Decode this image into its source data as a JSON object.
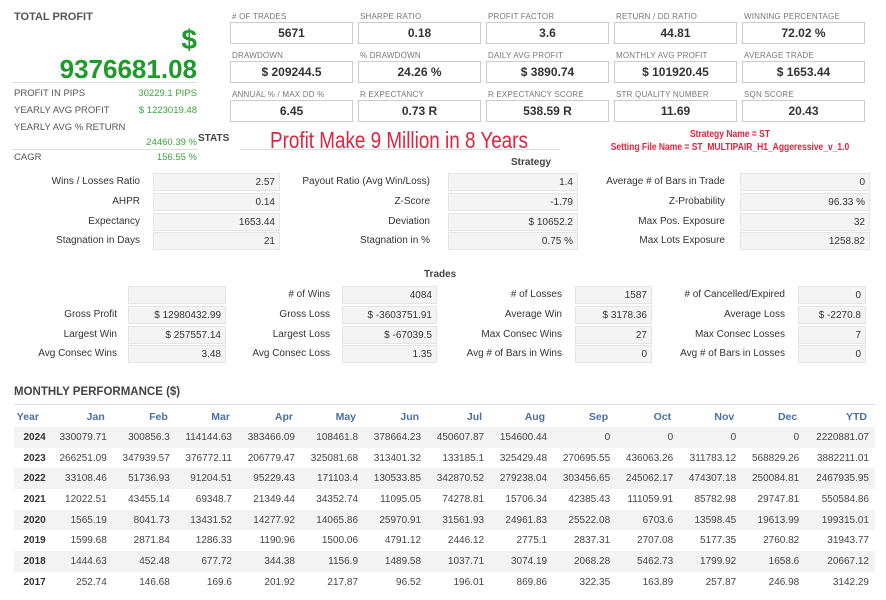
{
  "summary": {
    "total_profit_label": "TOTAL PROFIT",
    "currency": "$",
    "total_profit": "9376681.08",
    "rows": [
      {
        "label": "PROFIT IN PIPS",
        "value": "30229.1 PIPS"
      },
      {
        "label": "YEARLY AVG PROFIT",
        "value": "$ 1223019.48"
      },
      {
        "label": "YEARLY AVG % RETURN",
        "value": "24460.39 %"
      },
      {
        "label": "CAGR",
        "value": "156.55 %"
      }
    ]
  },
  "metrics": [
    {
      "label": "# OF TRADES",
      "value": "5671"
    },
    {
      "label": "SHARPE RATIO",
      "value": "0.18"
    },
    {
      "label": "PROFIT FACTOR",
      "value": "3.6"
    },
    {
      "label": "RETURN / DD RATIO",
      "value": "44.81"
    },
    {
      "label": "WINNING PERCENTAGE",
      "value": "72.02 %"
    },
    {
      "label": "DRAWDOWN",
      "value": "$ 209244.5"
    },
    {
      "label": "% DRAWDOWN",
      "value": "24.26 %"
    },
    {
      "label": "DAILY AVG PROFIT",
      "value": "$ 3890.74"
    },
    {
      "label": "MONTHLY AVG PROFIT",
      "value": "$ 101920.45"
    },
    {
      "label": "AVERAGE TRADE",
      "value": "$ 1653.44"
    },
    {
      "label": "ANNUAL % / MAX DD %",
      "value": "6.45"
    },
    {
      "label": "R EXPECTANCY",
      "value": "0.73 R"
    },
    {
      "label": "R EXPECTANCY SCORE",
      "value": "538.59 R"
    },
    {
      "label": "STR QUALITY NUMBER",
      "value": "11.69"
    },
    {
      "label": "SQN SCORE",
      "value": "20.43"
    }
  ],
  "headline": "Profit Make 9 Million in 8 Years",
  "strategy_name": "Strategy Name = ST",
  "setting_file": "Setting File Name = ST_MULTIPAIR_H1_Aggeressive_v_1.0",
  "stats": {
    "title": "STATS",
    "subtitle": "Strategy",
    "rows": [
      [
        [
          "Wins / Losses Ratio",
          "2.57"
        ],
        [
          "Payout Ratio (Avg Win/Loss)",
          "1.4"
        ],
        [
          "Average # of Bars in Trade",
          "0"
        ]
      ],
      [
        [
          "AHPR",
          "0.14"
        ],
        [
          "Z-Score",
          "-1.79"
        ],
        [
          "Z-Probability",
          "96.33 %"
        ]
      ],
      [
        [
          "Expectancy",
          "1653.44"
        ],
        [
          "Deviation",
          "$ 10652.2"
        ],
        [
          "Max Pos. Exposure",
          "32"
        ]
      ],
      [
        [
          "Stagnation in Days",
          "21"
        ],
        [
          "Stagnation in %",
          "0.75 %"
        ],
        [
          "Max Lots Exposure",
          "1258.82"
        ]
      ]
    ]
  },
  "trades": {
    "title": "Trades",
    "rows": [
      [
        [
          "",
          ""
        ],
        [
          "# of Wins",
          "4084"
        ],
        [
          "# of Losses",
          "1587"
        ],
        [
          "# of Cancelled/Expired",
          "0"
        ]
      ],
      [
        [
          "Gross Profit",
          "$ 12980432.99"
        ],
        [
          "Gross Loss",
          "$ -3603751.91"
        ],
        [
          "Average Win",
          "$ 3178.36"
        ],
        [
          "Average Loss",
          "$ -2270.8"
        ]
      ],
      [
        [
          "Largest Win",
          "$ 257557.14"
        ],
        [
          "Largest Loss",
          "$ -67039.5"
        ],
        [
          "Max Consec Wins",
          "27"
        ],
        [
          "Max Consec Losses",
          "7"
        ]
      ],
      [
        [
          "Avg Consec Wins",
          "3.48"
        ],
        [
          "Avg Consec Loss",
          "1.35"
        ],
        [
          "Avg # of Bars in Wins",
          "0"
        ],
        [
          "Avg # of Bars in Losses",
          "0"
        ]
      ]
    ]
  },
  "monthly": {
    "title": "MONTHLY PERFORMANCE ($)",
    "headers": [
      "Year",
      "Jan",
      "Feb",
      "Mar",
      "Apr",
      "May",
      "Jun",
      "Jul",
      "Aug",
      "Sep",
      "Oct",
      "Nov",
      "Dec",
      "YTD"
    ],
    "rows": [
      [
        "2024",
        "330079.71",
        "300856.3",
        "114144.63",
        "383466.09",
        "108461.8",
        "378664.23",
        "450607.87",
        "154600.44",
        "0",
        "0",
        "0",
        "0",
        "2220881.07"
      ],
      [
        "2023",
        "266251.09",
        "347939.57",
        "376772.11",
        "206779.47",
        "325081.68",
        "313401.32",
        "133185.1",
        "325429.48",
        "270695.55",
        "436063.26",
        "311783.12",
        "568829.26",
        "3882211.01"
      ],
      [
        "2022",
        "33108.46",
        "51736.93",
        "91204.51",
        "95229.43",
        "171103.4",
        "130533.85",
        "342870.52",
        "279238.04",
        "303456.65",
        "245062.17",
        "474307.18",
        "250084.81",
        "2467935.95"
      ],
      [
        "2021",
        "12022.51",
        "43455.14",
        "69348.7",
        "21349.44",
        "34352.74",
        "11095.05",
        "74278.81",
        "15706.34",
        "42385.43",
        "111059.91",
        "85782.98",
        "29747.81",
        "550584.86"
      ],
      [
        "2020",
        "1565.19",
        "8041.73",
        "13431.52",
        "14277.92",
        "14065.86",
        "25970.91",
        "31561.93",
        "24961.83",
        "25522.08",
        "6703.6",
        "13598.45",
        "19613.99",
        "199315.01"
      ],
      [
        "2019",
        "1599.68",
        "2871.84",
        "1286.33",
        "1190.96",
        "1500.06",
        "4791.12",
        "2446.12",
        "2775.1",
        "2837.31",
        "2707.08",
        "5177.35",
        "2760.82",
        "31943.77"
      ],
      [
        "2018",
        "1444.63",
        "452.48",
        "677.72",
        "344.38",
        "1156.9",
        "1489.58",
        "1037.71",
        "3074.19",
        "2068.28",
        "5462.73",
        "1799.92",
        "1658.6",
        "20667.12"
      ],
      [
        "2017",
        "252.74",
        "146.68",
        "169.6",
        "201.92",
        "217.87",
        "96.52",
        "196.01",
        "869.86",
        "322.35",
        "163.89",
        "257.87",
        "246.98",
        "3142.29"
      ]
    ]
  },
  "colors": {
    "profit_green": "#1e9a2a",
    "headline_red": "#e0223f",
    "header_blue": "#4a6fa5"
  }
}
